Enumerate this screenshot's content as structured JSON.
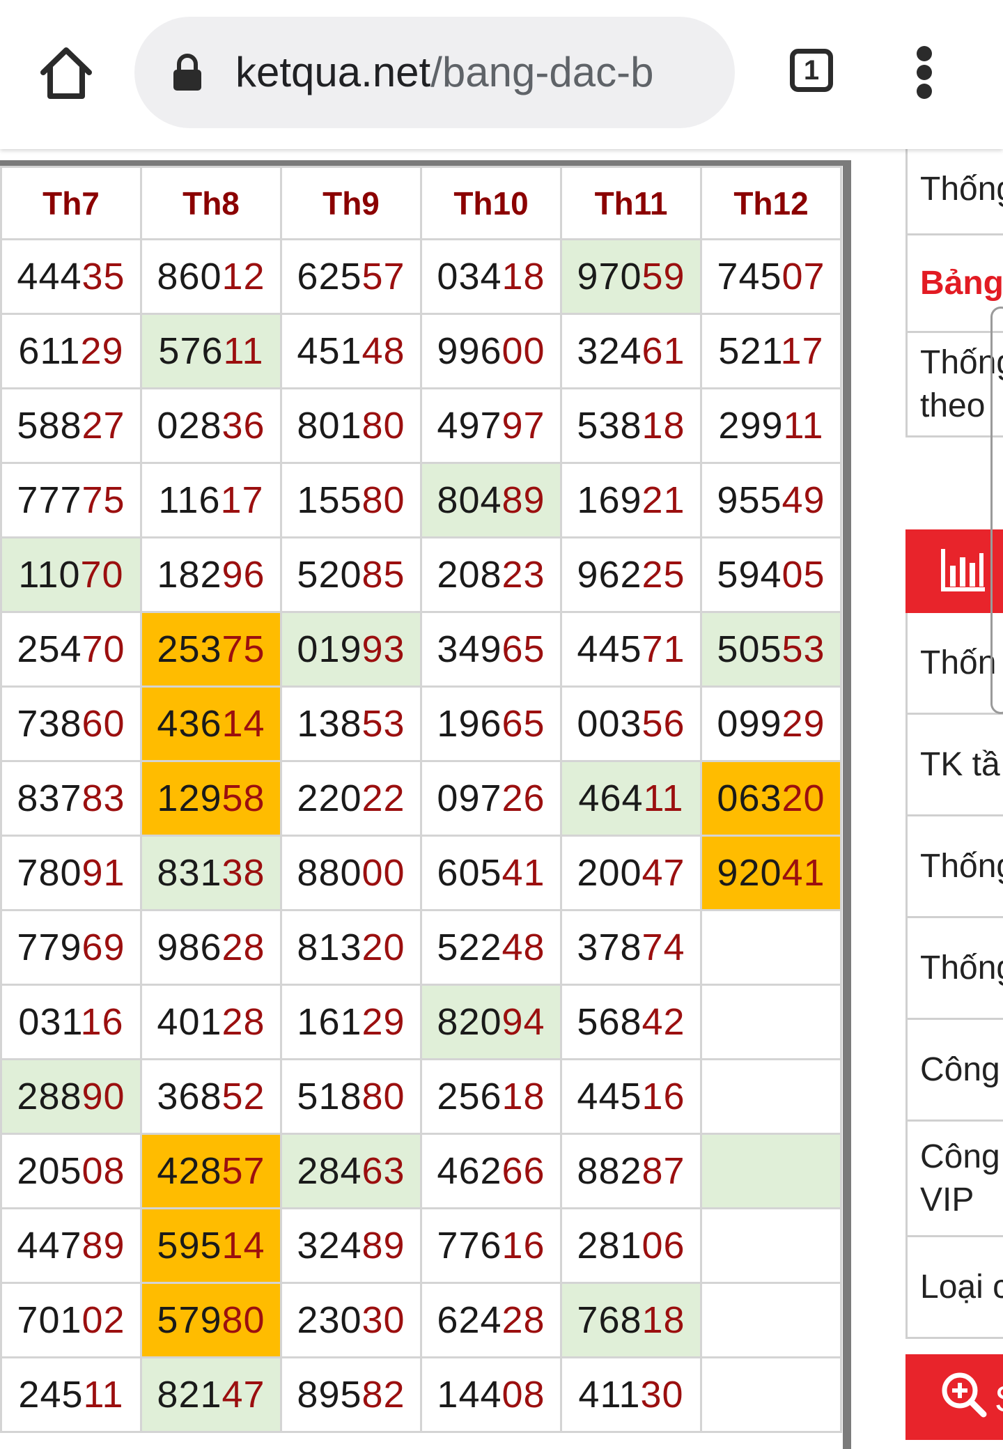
{
  "browser": {
    "url_host": "ketqua.net",
    "url_path": "/bang-dac-b",
    "tab_count": "1",
    "icons": {
      "home": "home-icon",
      "lock": "lock-icon",
      "more": "more-vert-icon"
    }
  },
  "table": {
    "headers": [
      "Th7",
      "Th8",
      "Th9",
      "Th10",
      "Th11",
      "Th12"
    ],
    "rows": [
      [
        "44435",
        "86012",
        "62557",
        "03418",
        "97059",
        "74507"
      ],
      [
        "61129",
        "57611",
        "45148",
        "99600",
        "32461",
        "52117"
      ],
      [
        "58827",
        "02836",
        "80180",
        "49797",
        "53818",
        "29911"
      ],
      [
        "77775",
        "11617",
        "15580",
        "80489",
        "16921",
        "95549"
      ],
      [
        "11070",
        "18296",
        "52085",
        "20823",
        "96225",
        "59405"
      ],
      [
        "25470",
        "25375",
        "01993",
        "34965",
        "44571",
        "50553"
      ],
      [
        "73860",
        "43614",
        "13853",
        "19665",
        "00356",
        "09929"
      ],
      [
        "83783",
        "12958",
        "22022",
        "09726",
        "46411",
        "06320"
      ],
      [
        "78091",
        "83138",
        "88000",
        "60541",
        "20047",
        "92041"
      ],
      [
        "77969",
        "98628",
        "81320",
        "52248",
        "37874",
        ""
      ],
      [
        "03116",
        "40128",
        "16129",
        "82094",
        "56842",
        ""
      ],
      [
        "28890",
        "36852",
        "51880",
        "25618",
        "44516",
        ""
      ],
      [
        "20508",
        "42857",
        "28463",
        "46266",
        "88287",
        ""
      ],
      [
        "44789",
        "59514",
        "32489",
        "77616",
        "28106",
        ""
      ],
      [
        "70102",
        "57980",
        "23030",
        "62428",
        "76818",
        ""
      ],
      [
        "24511",
        "82147",
        "89582",
        "14408",
        "41130",
        ""
      ]
    ],
    "highlights": [
      [
        "",
        "",
        "",
        "",
        "green",
        ""
      ],
      [
        "",
        "green",
        "",
        "",
        "",
        ""
      ],
      [
        "",
        "",
        "",
        "",
        "",
        ""
      ],
      [
        "",
        "",
        "",
        "green",
        "",
        ""
      ],
      [
        "green",
        "",
        "",
        "",
        "",
        ""
      ],
      [
        "",
        "orange",
        "green",
        "",
        "",
        "green"
      ],
      [
        "",
        "orange",
        "",
        "",
        "",
        ""
      ],
      [
        "",
        "orange",
        "",
        "",
        "green",
        "orange"
      ],
      [
        "",
        "green",
        "",
        "",
        "",
        "orange"
      ],
      [
        "",
        "",
        "",
        "",
        "",
        ""
      ],
      [
        "",
        "",
        "",
        "green",
        "",
        ""
      ],
      [
        "green",
        "",
        "",
        "",
        "",
        ""
      ],
      [
        "",
        "orange",
        "green",
        "",
        "",
        "green"
      ],
      [
        "",
        "orange",
        "",
        "",
        "",
        ""
      ],
      [
        "",
        "orange",
        "",
        "",
        "green",
        ""
      ],
      [
        "",
        "green",
        "",
        "",
        "",
        ""
      ]
    ]
  },
  "sidebar": {
    "items": [
      {
        "text": "Thống",
        "style": "normal"
      },
      {
        "text": "Bảng",
        "style": "title"
      },
      {
        "text": "Thống theo",
        "style": "two-line"
      },
      {
        "text": "",
        "style": "redbar",
        "icon": "bar-chart-icon"
      },
      {
        "text": "Thốn",
        "style": "normal"
      },
      {
        "text": "TK tầ",
        "style": "normal"
      },
      {
        "text": "Thống",
        "style": "normal"
      },
      {
        "text": "Thống",
        "style": "normal"
      },
      {
        "text": "Công",
        "style": "normal"
      },
      {
        "text": "Công VIP",
        "style": "two-line"
      },
      {
        "text": "Loại c",
        "style": "normal"
      },
      {
        "text": "S",
        "style": "redbar",
        "icon": "zoom-in-icon"
      }
    ]
  },
  "colors": {
    "header_text": "#8b0000",
    "digit_tail": "#9b0f0f",
    "highlight_green": "#e0efd8",
    "highlight_orange": "#ffbc00",
    "sidebar_red": "#e8242b"
  }
}
